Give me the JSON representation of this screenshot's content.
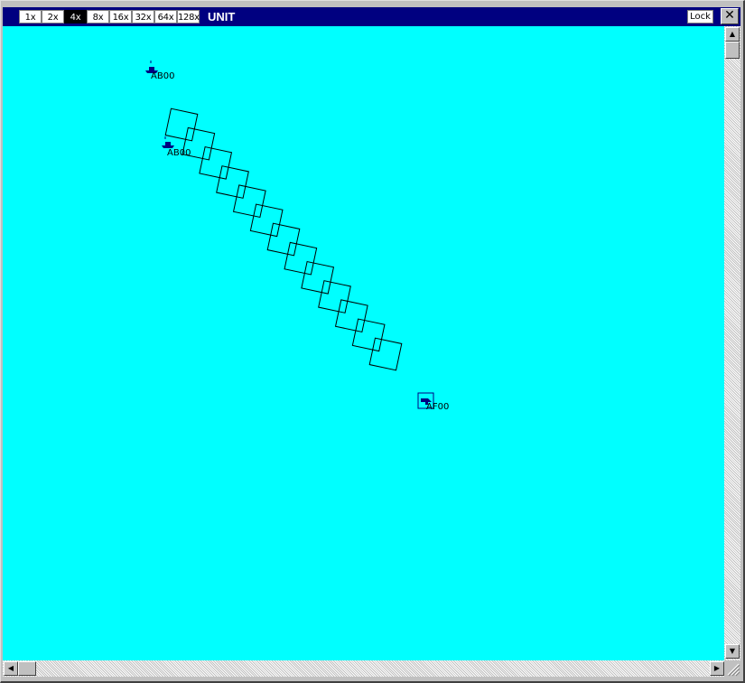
{
  "window": {
    "title": "UNIT",
    "lock_label": "Lock",
    "close_glyph": "✕"
  },
  "zoom": {
    "levels": [
      "1x",
      "2x",
      "4x",
      "8x",
      "16x",
      "32x",
      "64x",
      "128x"
    ],
    "selected": "4x"
  },
  "map": {
    "background_color": "#00ffff",
    "units": [
      {
        "label": "AB00",
        "icon": "ship-icon"
      },
      {
        "label": "AB00",
        "icon": "ship-icon"
      },
      {
        "label": "AF00",
        "icon": "aircraft-icon"
      }
    ],
    "track_box_count": 13
  },
  "scrollbars": {
    "up_glyph": "▲",
    "down_glyph": "▼",
    "left_glyph": "◀",
    "right_glyph": "▶"
  }
}
